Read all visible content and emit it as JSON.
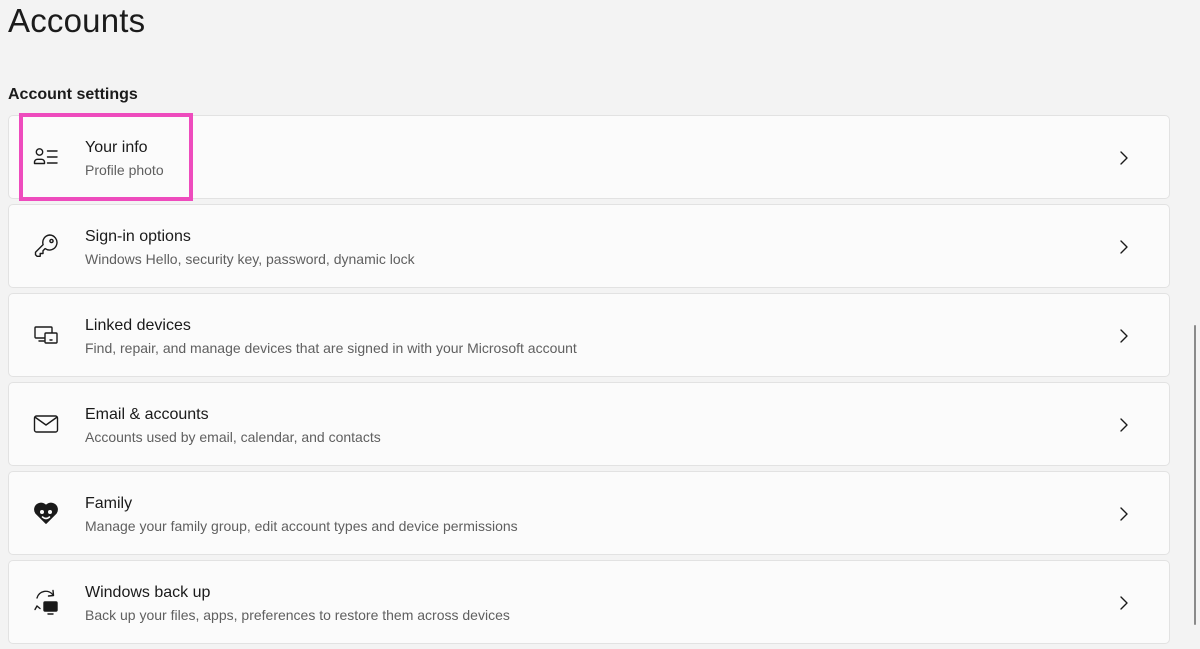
{
  "page": {
    "title": "Accounts",
    "section_title": "Account settings"
  },
  "settings": [
    {
      "label": "Your info",
      "description": "Profile photo",
      "icon": "person-card-icon",
      "highlighted": true
    },
    {
      "label": "Sign-in options",
      "description": "Windows Hello, security key, password, dynamic lock",
      "icon": "key-icon"
    },
    {
      "label": "Linked devices",
      "description": "Find, repair, and manage devices that are signed in with your Microsoft account",
      "icon": "devices-icon"
    },
    {
      "label": "Email & accounts",
      "description": "Accounts used by email, calendar, and contacts",
      "icon": "mail-icon"
    },
    {
      "label": "Family",
      "description": "Manage your family group, edit account types and device permissions",
      "icon": "family-heart-icon"
    },
    {
      "label": "Windows back up",
      "description": "Back up your files, apps, preferences to restore them across devices",
      "icon": "backup-icon"
    }
  ],
  "colors": {
    "background": "#f3f3f3",
    "card": "#fbfbfb",
    "highlight": "#ee4bbd"
  }
}
